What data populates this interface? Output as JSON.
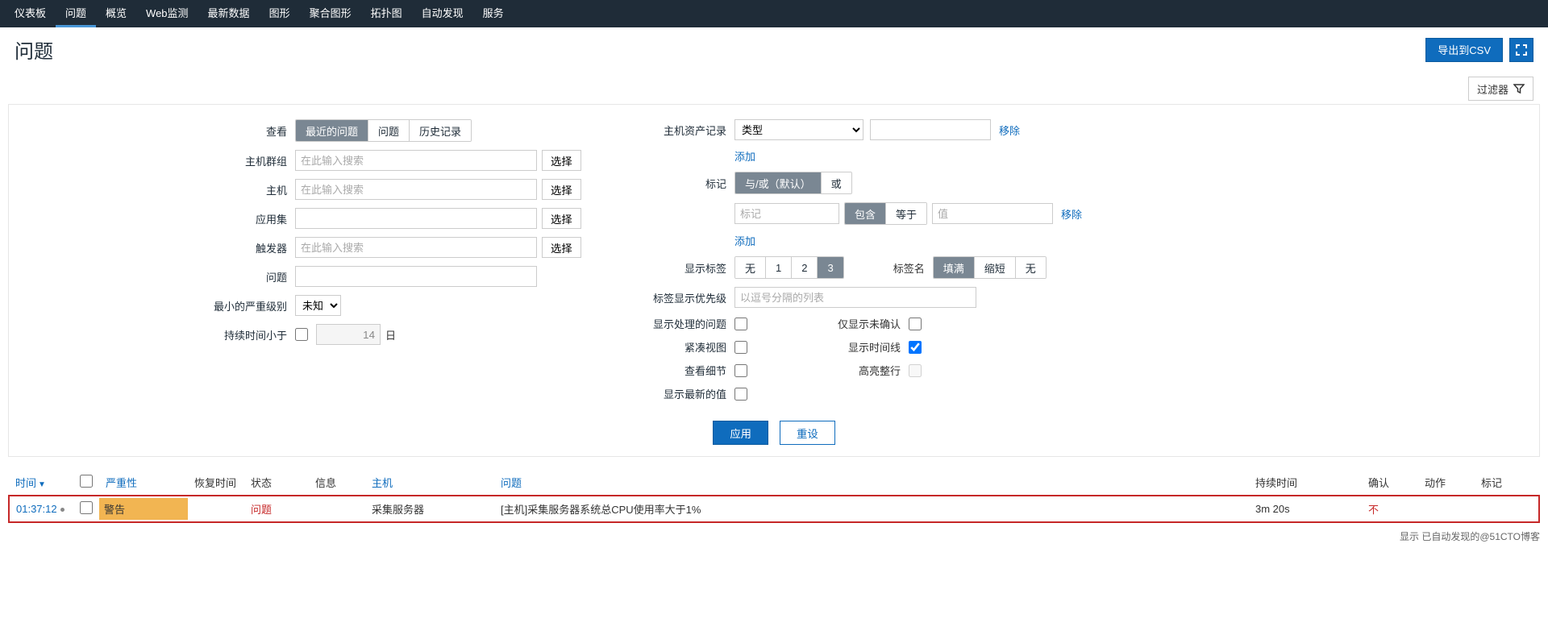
{
  "nav": {
    "items": [
      "仪表板",
      "问题",
      "概览",
      "Web监测",
      "最新数据",
      "图形",
      "聚合图形",
      "拓扑图",
      "自动发现",
      "服务"
    ],
    "active_index": 1
  },
  "header": {
    "title": "问题",
    "export_label": "导出到CSV"
  },
  "filter_bar": {
    "label": "过滤器"
  },
  "filters": {
    "view": {
      "label": "查看",
      "options": [
        "最近的问题",
        "问题",
        "历史记录"
      ],
      "active_index": 0
    },
    "host_group": {
      "label": "主机群组",
      "placeholder": "在此输入搜索",
      "select_btn": "选择"
    },
    "host": {
      "label": "主机",
      "placeholder": "在此输入搜索",
      "select_btn": "选择"
    },
    "app": {
      "label": "应用集",
      "value": "",
      "select_btn": "选择"
    },
    "trigger": {
      "label": "触发器",
      "placeholder": "在此输入搜索",
      "select_btn": "选择"
    },
    "problem": {
      "label": "问题",
      "value": ""
    },
    "min_severity": {
      "label": "最小的严重级别",
      "value": "未知"
    },
    "age_lt": {
      "label": "持续时间小于",
      "checked": false,
      "value": "14",
      "unit": "日"
    },
    "inventory": {
      "label": "主机资产记录",
      "type_value": "类型",
      "second_value": "",
      "remove": "移除",
      "add": "添加"
    },
    "tags": {
      "label": "标记",
      "mode_options": [
        "与/或（默认）",
        "或"
      ],
      "mode_active": 0,
      "tag_placeholder": "标记",
      "op_options": [
        "包含",
        "等于"
      ],
      "op_active": 0,
      "value_placeholder": "值",
      "remove": "移除",
      "add": "添加"
    },
    "show_tags": {
      "label": "显示标签",
      "options": [
        "无",
        "1",
        "2",
        "3"
      ],
      "active_index": 3,
      "name_label": "标签名",
      "name_options": [
        "填满",
        "缩短",
        "无"
      ],
      "name_active": 0
    },
    "tag_priority": {
      "label": "标签显示优先级",
      "placeholder": "以逗号分隔的列表"
    },
    "show_suppressed": {
      "label": "显示处理的问题",
      "checked": false
    },
    "show_unack_only": {
      "label": "仅显示未确认",
      "checked": false
    },
    "compact": {
      "label": "紧凑视图",
      "checked": false
    },
    "show_timeline": {
      "label": "显示时间线",
      "checked": true
    },
    "details": {
      "label": "查看细节",
      "checked": false
    },
    "highlight_row": {
      "label": "高亮整行",
      "checked": false
    },
    "show_latest": {
      "label": "显示最新的值",
      "checked": false
    },
    "apply": "应用",
    "reset": "重设"
  },
  "table": {
    "headers": {
      "time": "时间",
      "severity": "严重性",
      "recovery": "恢复时间",
      "status": "状态",
      "info": "信息",
      "host": "主机",
      "problem": "问题",
      "duration": "持续时间",
      "ack": "确认",
      "actions": "动作",
      "tags": "标记"
    },
    "rows": [
      {
        "time": "01:37:12",
        "severity": "警告",
        "recovery": "",
        "status": "问题",
        "info": "",
        "host": "采集服务器",
        "problem": "[主机]采集服务器系统总CPU使用率大于1%",
        "duration": "3m 20s",
        "ack": "不",
        "actions": "",
        "tags": ""
      }
    ]
  },
  "footer": {
    "text": "显示 已自动发现的@51CTO博客"
  }
}
